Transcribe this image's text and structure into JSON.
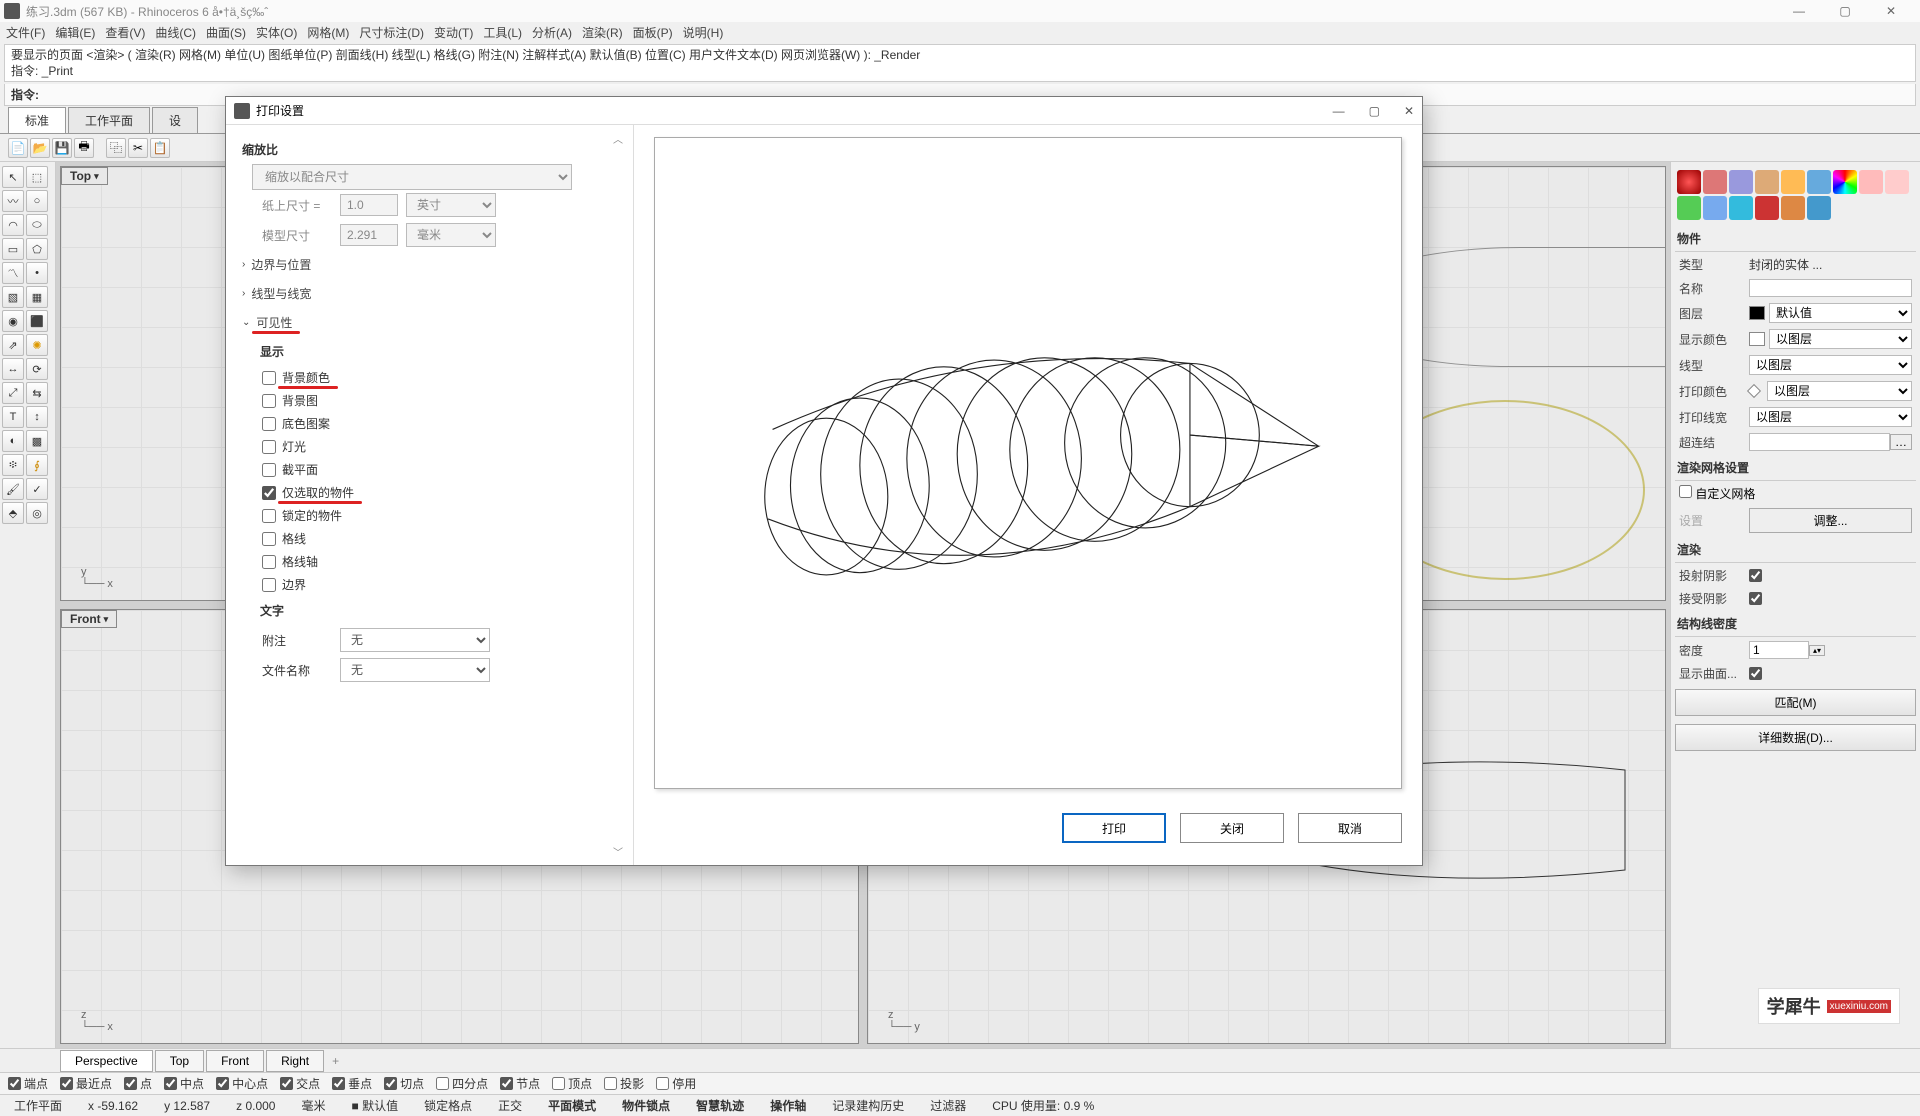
{
  "window": {
    "title": "练习.3dm (567 KB) - Rhinoceros 6 å•†ä¸šç‰ˆ",
    "ctrl_min": "—",
    "ctrl_max": "▢",
    "ctrl_close": "✕"
  },
  "menu": [
    "文件(F)",
    "编辑(E)",
    "查看(V)",
    "曲线(C)",
    "曲面(S)",
    "实体(O)",
    "网格(M)",
    "尺寸标注(D)",
    "变动(T)",
    "工具(L)",
    "分析(A)",
    "渲染(R)",
    "面板(P)",
    "说明(H)"
  ],
  "cmd": {
    "line1": "要显示的页面 <渲染>  ( 渲染(R)  网格(M)  单位(U)  图纸单位(P)  剖面线(H)  线型(L)  格线(G)  附注(N)  注解样式(A)  默认值(B)  位置(C)  用户文件文本(D)  网页浏览器(W) ):  _Render",
    "line2": "指令: _Print",
    "prompt": "指令:"
  },
  "tabs": [
    "标准",
    "工作平面",
    "设"
  ],
  "viewport_labels": {
    "top": "Top",
    "front": "Front",
    "persp": "Perspective",
    "right": "Right"
  },
  "dialog": {
    "title": "打印设置",
    "scale_head": "缩放比",
    "scale_select": "缩放以配合尺寸",
    "paper_label": "纸上尺寸 =",
    "paper_val": "1.0",
    "paper_unit": "英寸",
    "model_label": "模型尺寸",
    "model_val": "2.291",
    "model_unit": "毫米",
    "sec_boundary": "边界与位置",
    "sec_linetype": "线型与线宽",
    "sec_visibility": "可见性",
    "display_head": "显示",
    "chk_bgcolor": "背景颜色",
    "chk_bgimg": "背景图",
    "chk_pattern": "底色图案",
    "chk_lights": "灯光",
    "chk_clip": "截平面",
    "chk_selonly": "仅选取的物件",
    "chk_locked": "锁定的物件",
    "chk_grid": "格线",
    "chk_gridaxis": "格线轴",
    "chk_border": "边界",
    "text_head": "文字",
    "annot_label": "附注",
    "annot_val": "无",
    "filename_label": "文件名称",
    "filename_val": "无",
    "btn_print": "打印",
    "btn_close": "关闭",
    "btn_cancel": "取消"
  },
  "right": {
    "obj_head": "物件",
    "k_type": "类型",
    "v_type": "封闭的实体 ...",
    "k_name": "名称",
    "v_name": "",
    "k_layer": "图层",
    "v_layer": "默认值",
    "k_dispcolor": "显示颜色",
    "v_dispcolor": "以图层",
    "k_linetype": "线型",
    "v_linetype": "以图层",
    "k_printcolor": "打印颜色",
    "v_printcolor": "以图层",
    "k_printwidth": "打印线宽",
    "v_printwidth": "以图层",
    "k_hyper": "超连结",
    "rendermesh_head": "渲染网格设置",
    "chk_custommesh": "自定义网格",
    "lbl_settings": "设置",
    "btn_adjust": "调整...",
    "render_head": "渲染",
    "chk_cast": "投射阴影",
    "chk_recv": "接受阴影",
    "iso_head": "结构线密度",
    "k_density": "密度",
    "v_density": "1",
    "chk_disp_surf": "显示曲面...",
    "btn_match": "匹配(M)",
    "btn_detail": "详细数据(D)..."
  },
  "osnap": {
    "end": "端点",
    "near": "最近点",
    "pt": "点",
    "mid": "中点",
    "cen": "中心点",
    "int": "交点",
    "perp": "垂点",
    "tan": "切点",
    "quad": "四分点",
    "knot": "节点",
    "vtx": "顶点",
    "proj": "投影",
    "disable": "停用"
  },
  "status": {
    "plane": "工作平面",
    "x": "x -59.162",
    "y": "y 12.587",
    "z": "z 0.000",
    "unit": "毫米",
    "layer": "默认值",
    "gridsnap": "锁定格点",
    "ortho": "正交",
    "planar": "平面模式",
    "osnap_s": "物件锁点",
    "smart": "智慧轨迹",
    "gumball": "操作轴",
    "record": "记录建构历史",
    "filter": "过滤器",
    "cpu": "CPU 使用量: 0.9 %"
  },
  "vp_tabs": [
    "Perspective",
    "Top",
    "Front",
    "Right"
  ],
  "watermark": {
    "text": "学犀牛",
    "sub": "xuexiniu.com"
  }
}
